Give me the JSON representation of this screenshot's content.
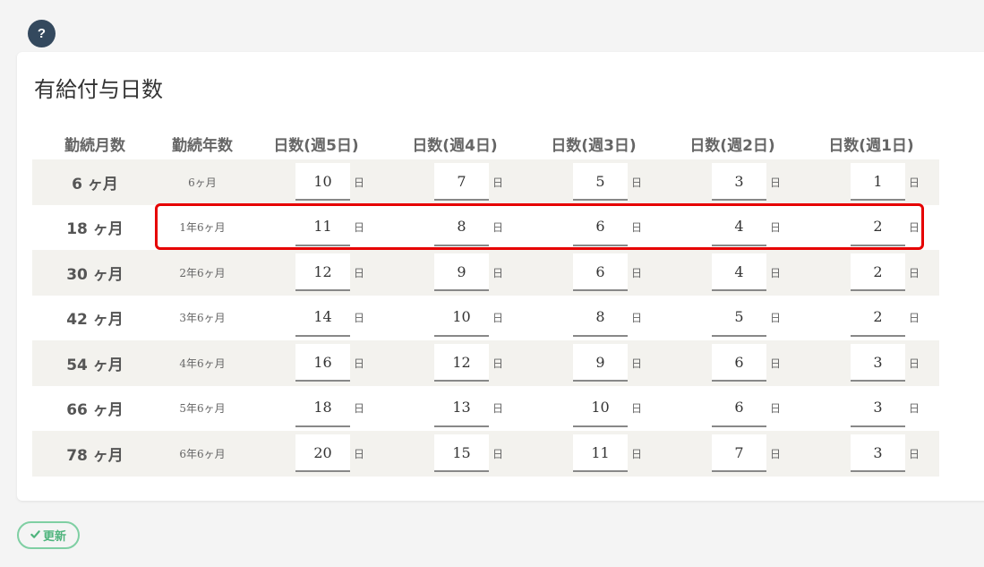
{
  "help": {
    "label": "?"
  },
  "card": {
    "title": "有給付与日数"
  },
  "table": {
    "headers": [
      "勤続月数",
      "勤続年数",
      "日数(週5日)",
      "日数(週4日)",
      "日数(週3日)",
      "日数(週2日)",
      "日数(週1日)"
    ],
    "unit": "日",
    "rows": [
      {
        "months": "6 ヶ月",
        "years": "6ヶ月",
        "days": [
          "10",
          "7",
          "5",
          "3",
          "1"
        ]
      },
      {
        "months": "18 ヶ月",
        "years": "1年6ヶ月",
        "days": [
          "11",
          "8",
          "6",
          "4",
          "2"
        ]
      },
      {
        "months": "30 ヶ月",
        "years": "2年6ヶ月",
        "days": [
          "12",
          "9",
          "6",
          "4",
          "2"
        ]
      },
      {
        "months": "42 ヶ月",
        "years": "3年6ヶ月",
        "days": [
          "14",
          "10",
          "8",
          "5",
          "2"
        ]
      },
      {
        "months": "54 ヶ月",
        "years": "4年6ヶ月",
        "days": [
          "16",
          "12",
          "9",
          "6",
          "3"
        ]
      },
      {
        "months": "66 ヶ月",
        "years": "5年6ヶ月",
        "days": [
          "18",
          "13",
          "10",
          "6",
          "3"
        ]
      },
      {
        "months": "78 ヶ月",
        "years": "6年6ヶ月",
        "days": [
          "20",
          "15",
          "11",
          "7",
          "3"
        ]
      }
    ]
  },
  "footer": {
    "update_label": "更新"
  },
  "colors": {
    "highlight": "#e60000",
    "update_accent": "#4fb47d",
    "help_bg": "#34495e"
  }
}
